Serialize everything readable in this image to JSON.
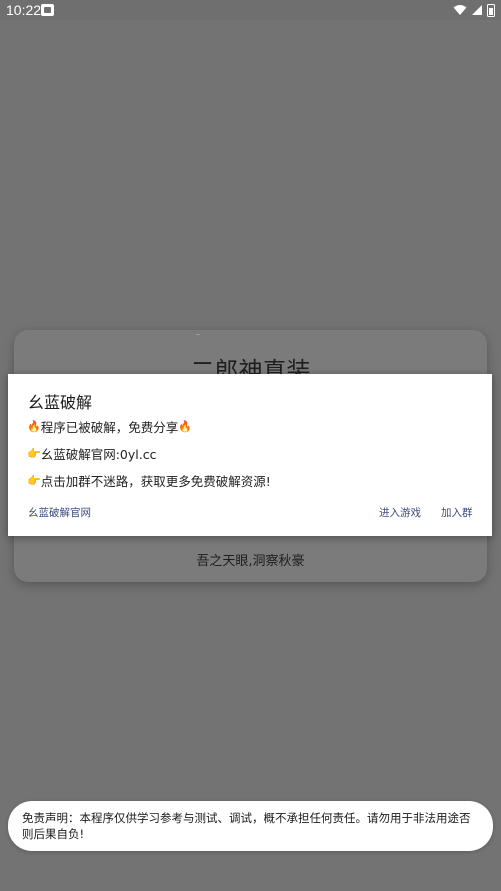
{
  "status_bar": {
    "time": "10:22",
    "icons": [
      "app-notification-icon",
      "wifi-icon",
      "signal-icon",
      "battery-icon"
    ]
  },
  "background_card": {
    "title": "二郎神真装",
    "subtitle": "吾之天眼,洞察秋豪"
  },
  "dialog": {
    "title": "幺蓝破解",
    "lines": [
      {
        "prefix_icon": "🔥",
        "text": "程序已被破解，免费分享",
        "suffix_icon": "🔥"
      },
      {
        "prefix_icon": "👉",
        "text": "幺蓝破解官网:0yl.cc"
      },
      {
        "prefix_icon": "👉",
        "text": "点击加群不迷路，获取更多免费破解资源!"
      }
    ],
    "neutral_button": "幺蓝破解官网",
    "negative_button": "进入游戏",
    "positive_button": "加入群"
  },
  "toast": {
    "text": "免责声明：本程序仅供学习参考与测试、调试，概不承担任何责任。请勿用于非法用途否则后果自负!"
  }
}
